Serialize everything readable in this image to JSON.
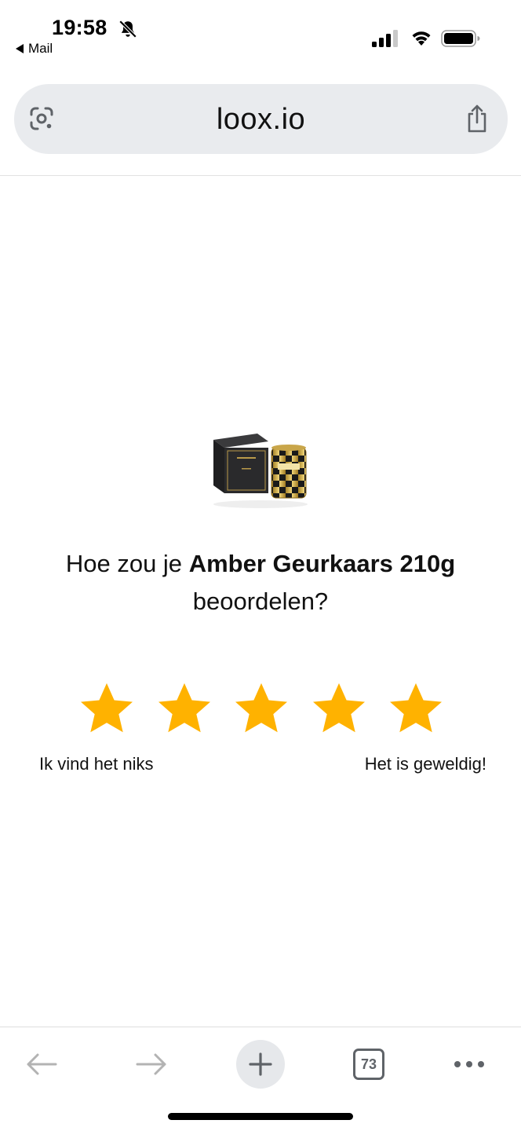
{
  "status_bar": {
    "time": "19:58",
    "back_label": "Mail",
    "icons": [
      "bell-off-icon",
      "cellular-signal-icon",
      "wifi-icon",
      "battery-icon"
    ]
  },
  "browser": {
    "url": "loox.io",
    "icons": [
      "google-lens-icon",
      "share-icon"
    ]
  },
  "review": {
    "question_prefix": "Hoe zou je",
    "product_name": "Amber Geurkaars 210g",
    "question_suffix": "beoordelen?",
    "star_color": "#FFB200",
    "star_count": 5,
    "label_low": "Ik vind het niks",
    "label_high": "Het is geweldig!"
  },
  "toolbar": {
    "tab_count": "73",
    "icons": [
      "back-arrow-icon",
      "forward-arrow-icon",
      "plus-icon",
      "tabs-icon",
      "more-icon"
    ]
  }
}
